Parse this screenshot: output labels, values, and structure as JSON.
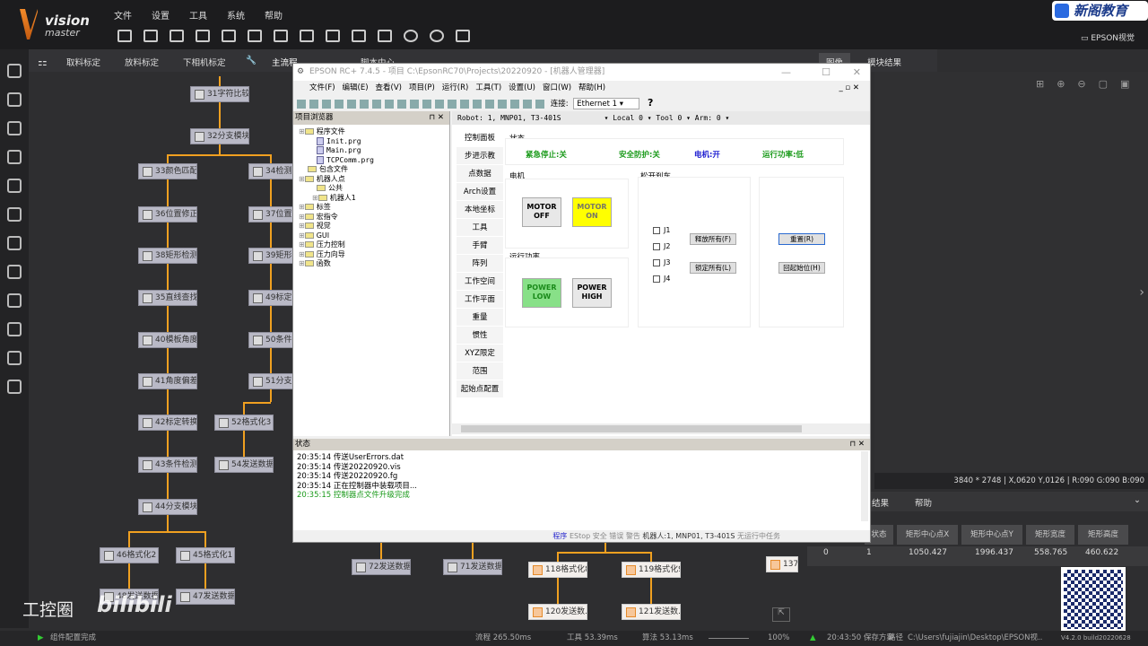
{
  "app": {
    "logo_top": "vision",
    "logo_bottom": "master",
    "menu": [
      "文件",
      "设置",
      "工具",
      "系统",
      "帮助"
    ],
    "right_label": "EPSON视觉",
    "watermark": "新阁教育",
    "bilibili": "bilibili",
    "gongkong": "工控圈"
  },
  "tabs": [
    "取料标定",
    "放料标定",
    "下相机标定",
    "主流程",
    "脚本中心"
  ],
  "right_tabs": [
    "图像",
    "模块结果"
  ],
  "flow_nodes": [
    "31字符比较2",
    "32分支模块2",
    "33颜色匹配",
    "34检测",
    "36位置修正1",
    "37位置",
    "38矩形检测1",
    "39矩形",
    "35直线查找1",
    "49标定",
    "40模板角度",
    "50条件",
    "41角度偏差",
    "51分支",
    "42标定转换1",
    "52格式化3",
    "43条件检测1",
    "54发送数据3",
    "44分支模块3",
    "46格式化2",
    "45格式化1",
    "48发送数据2",
    "47发送数据1",
    "72发送数据7",
    "71发送数据6",
    "118格式化8",
    "119格式化9",
    "120发送数...",
    "121发送数...",
    "137"
  ],
  "epson": {
    "title": "EPSON RC+ 7.4.5 - 项目 C:\\EpsonRC70\\Projects\\20220920 - [机器人管理器]",
    "menu": [
      "文件(F)",
      "编辑(E)",
      "查看(V)",
      "项目(P)",
      "运行(R)",
      "工具(T)",
      "设置(U)",
      "窗口(W)",
      "帮助(H)"
    ],
    "connect_label": "连接:",
    "connection": "Ethernet 1",
    "tree_title": "项目浏览器",
    "tree": [
      {
        "label": "程序文件",
        "type": "folder",
        "lvl": 0
      },
      {
        "label": "Init.prg",
        "type": "file",
        "lvl": 2
      },
      {
        "label": "Main.prg",
        "type": "file",
        "lvl": 2
      },
      {
        "label": "TCPComm.prg",
        "type": "file",
        "lvl": 2
      },
      {
        "label": "包含文件",
        "type": "folder",
        "lvl": 1
      },
      {
        "label": "机器人点",
        "type": "folder",
        "lvl": 0
      },
      {
        "label": "公共",
        "type": "folder",
        "lvl": 2
      },
      {
        "label": "机器人1",
        "type": "folder",
        "lvl": 1.5
      },
      {
        "label": "标签",
        "type": "folder",
        "lvl": 0
      },
      {
        "label": "宏指令",
        "type": "folder",
        "lvl": 0
      },
      {
        "label": "视觉",
        "type": "folder",
        "lvl": 0
      },
      {
        "label": "GUI",
        "type": "folder",
        "lvl": 0
      },
      {
        "label": "压力控制",
        "type": "folder",
        "lvl": 0
      },
      {
        "label": "压力向导",
        "type": "folder",
        "lvl": 0
      },
      {
        "label": "函数",
        "type": "folder",
        "lvl": 0
      }
    ],
    "robot_bar": {
      "robot": "Robot: 1, MNP01, T3-401S",
      "local": "Local 0",
      "tool": "Tool 0",
      "arm": "Arm: 0"
    },
    "side_tabs": [
      "控制面板",
      "步进示教",
      "点数据",
      "Arch设置",
      "本地坐标",
      "工具",
      "手臂",
      "阵列",
      "工作空间",
      "工作平面",
      "重量",
      "惯性",
      "XYZ限定",
      "范围",
      "起始点配置"
    ],
    "status_group": "状态",
    "status_items": [
      {
        "text": "紧急停止:关",
        "color": "#1a9a1a"
      },
      {
        "text": "安全防护:关",
        "color": "#1a9a1a"
      },
      {
        "text": "电机:开",
        "color": "#1a1ad0"
      },
      {
        "text": "运行功率:低",
        "color": "#1a9a1a"
      }
    ],
    "motor_group": "电机",
    "motor_off": "MOTOR\nOFF",
    "motor_on": "MOTOR\nON",
    "power_group": "运行功率",
    "power_low": "POWER\nLOW",
    "power_high": "POWER\nHIGH",
    "brake_group": "松开刹车",
    "joints": [
      "J1",
      "J2",
      "J3",
      "J4"
    ],
    "release_all": "释放所有(F)",
    "lock_all": "锁定所有(L)",
    "reset": "重置(R)",
    "home": "回起始位(H)",
    "status_panel_title": "状态",
    "log": [
      {
        "text": "20:35:14 传送UserErrors.dat",
        "color": "#000"
      },
      {
        "text": "20:35:14 传送20220920.vis",
        "color": "#000"
      },
      {
        "text": "20:35:14 传送20220920.fg",
        "color": "#000"
      },
      {
        "text": "20:35:14 正在控制器中装载项目...",
        "color": "#000"
      },
      {
        "text": "20:35:15 控制器点文件升级完成",
        "color": "#1a9a1a"
      }
    ],
    "statusbar": {
      "program": "程序",
      "estop": "EStop",
      "safety": "安全",
      "error": "错误",
      "warning": "警告",
      "robot": "机器人:1, MNP01, T3-401S",
      "tasks": "无运行中任务"
    }
  },
  "image_info": "3840 * 2748  | X,0620 Y,0126 | R:090 G:090 B:090",
  "result_tabs": [
    "结果",
    "帮助"
  ],
  "table": {
    "headers": [
      "状态",
      "矩形中心点X",
      "矩形中心点Y",
      "矩形宽度",
      "矩形高度"
    ],
    "row": [
      "0",
      "1",
      "1050.427",
      "1996.437",
      "558.765",
      "460.622"
    ]
  },
  "bottom": {
    "status": "组件配置完成",
    "flow_time": "流程 265.50ms",
    "tool_time": "工具 53.39ms",
    "algo_time": "算法 53.13ms",
    "zoom": "100%",
    "save_time": "20:43:50 保存方案",
    "path_label": "路径",
    "path": "C:\\Users\\fujiajin\\Desktop\\EPSON视...",
    "version": "V4.2.0 build20220628"
  }
}
